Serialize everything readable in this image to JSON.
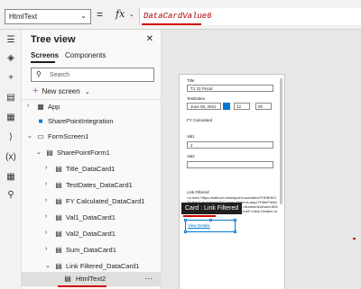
{
  "formula_bar": {
    "property": "HtmlText",
    "equals": "=",
    "fx": "fx",
    "formula": "DataCardValue6"
  },
  "tree": {
    "title": "Tree view",
    "tabs": [
      {
        "label": "Screens",
        "active": true
      },
      {
        "label": "Components",
        "active": false
      }
    ],
    "search_placeholder": "Search",
    "new_screen": "New screen",
    "nodes": [
      {
        "label": "App"
      },
      {
        "label": "SharePointIntegration"
      },
      {
        "label": "FormScreen1"
      },
      {
        "label": "SharePointForm1"
      },
      {
        "label": "Title_DataCard1"
      },
      {
        "label": "TestDates_DataCard1"
      },
      {
        "label": "FY Calculated_DataCard1"
      },
      {
        "label": "Val1_DataCard1"
      },
      {
        "label": "Val2_DataCard1"
      },
      {
        "label": "Sum_DataCard1"
      },
      {
        "label": "Link Filtered_DataCard1"
      },
      {
        "label": "HtmlText2",
        "selected": true
      }
    ]
  },
  "form": {
    "title_label": "Title",
    "title_value": "T1 22 Fiscal",
    "testdates_label": "TestDates",
    "testdates_value": "June 08, 2021",
    "hour_value": "12",
    "minute_value": "00",
    "fy_label": "FY Calculated",
    "val1_label": "Val1",
    "val1_value": "2",
    "val2_label": "Val2",
    "tooltip": "Card : Link Filtered",
    "link_label": "Link Filtered",
    "link_html": "<a href='https://batboch.sharepoint.com/sites/THEBISCIT/Lists/Calculates%20Column/AllItems.aspx?FilterField1=Sum&FilterValue1=2&FilterType1=Number&viewid=8930D229-9A47-4015-9A79-5d4eb04b1a9'>View Details</a>",
    "link_display": "View Details"
  },
  "colors": {
    "accent": "#0078d4",
    "formula_text": "#a80000",
    "annotation": "#d40000",
    "new_screen_icon": "#8764b8"
  }
}
